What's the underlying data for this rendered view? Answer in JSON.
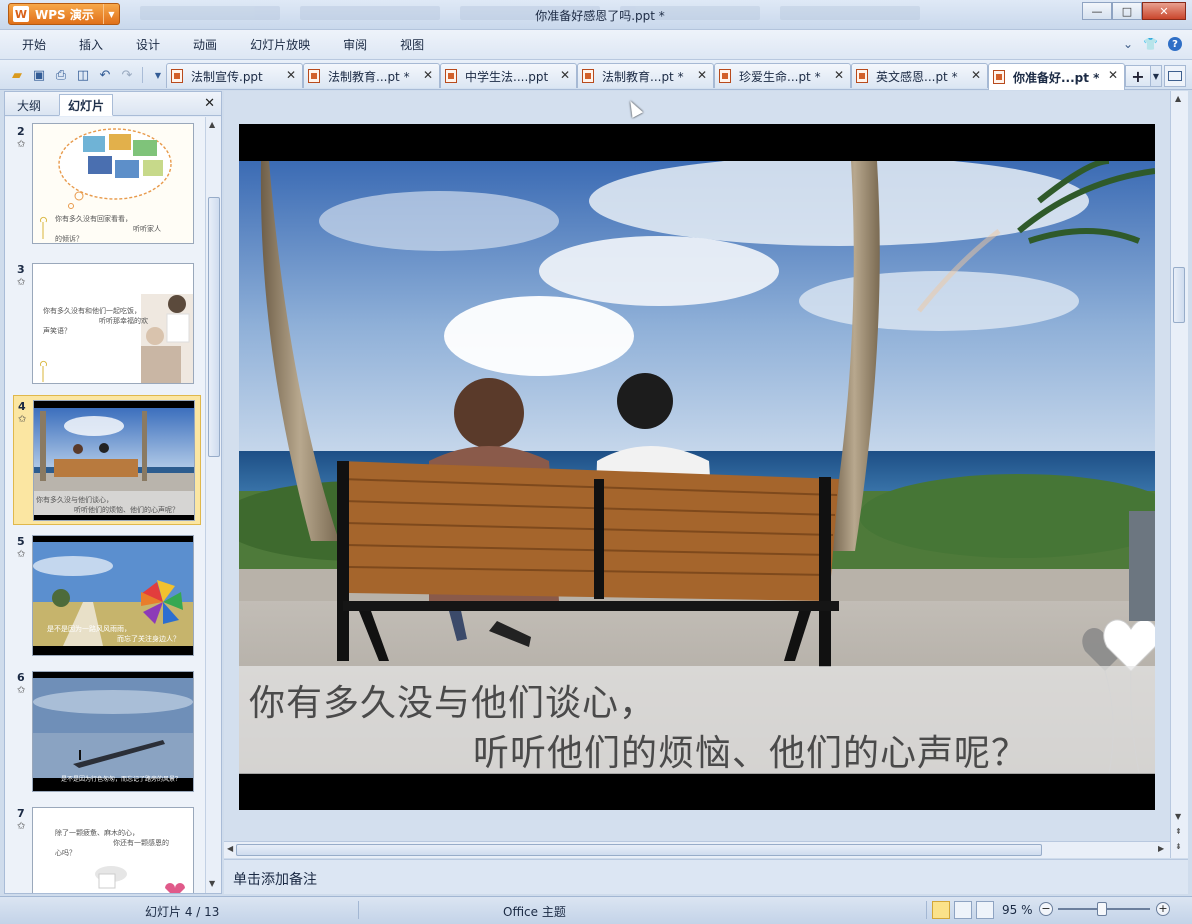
{
  "app": {
    "button_label": "WPS 演示",
    "logo_letter": "W",
    "document_title": "你准备好感恩了吗.ppt *",
    "window_controls": {
      "minimize": "—",
      "maximize": "□",
      "close": "✕"
    }
  },
  "menu": {
    "items": [
      "开始",
      "插入",
      "设计",
      "动画",
      "幻灯片放映",
      "审阅",
      "视图"
    ]
  },
  "doc_tabs": [
    {
      "label": "法制宣传.ppt",
      "active": false
    },
    {
      "label": "法制教育...pt *",
      "active": false
    },
    {
      "label": "中学生法....ppt",
      "active": false
    },
    {
      "label": "法制教育...pt *",
      "active": false
    },
    {
      "label": "珍爱生命...pt *",
      "active": false
    },
    {
      "label": "英文感恩...pt *",
      "active": false
    },
    {
      "label": "你准备好...pt *",
      "active": true
    }
  ],
  "left_panel": {
    "tab_outline": "大纲",
    "tab_slides": "幻灯片",
    "thumbnails": [
      {
        "num": "2",
        "text1": "你有多久没有回家看看，",
        "text2": "听听家人",
        "text3": "的倾诉？"
      },
      {
        "num": "3",
        "text1": "你有多久没有和他们一起吃饭，",
        "text2": "听听那幸福的欢",
        "text3": "声笑语？"
      },
      {
        "num": "4",
        "text1": "你有多久没与他们谈心，",
        "text2": "听听他们的烦恼、他们的心声呢？",
        "text3": ""
      },
      {
        "num": "5",
        "text1": "是不是因为一路风风雨雨，",
        "text2": "而忘了关注身边人？",
        "text3": ""
      },
      {
        "num": "6",
        "text1": "是不是因为行色匆匆，而忘记了路旁的风景？",
        "text2": "",
        "text3": ""
      },
      {
        "num": "7",
        "text1": "除了一颗疲惫、麻木的心，",
        "text2": "你还有一颗感恩的",
        "text3": "心吗？"
      }
    ]
  },
  "slide": {
    "caption_line1": "你有多久没与他们谈心，",
    "caption_line2": "听听他们的烦恼、他们的心声呢？"
  },
  "notes": {
    "placeholder": "单击添加备注"
  },
  "status": {
    "slide_counter": "幻灯片 4 / 13",
    "theme": "Office 主题",
    "zoom": "95 %"
  },
  "colors": {
    "wps_orange": "#e0701a",
    "selected_thumb": "#fbe6a2"
  }
}
